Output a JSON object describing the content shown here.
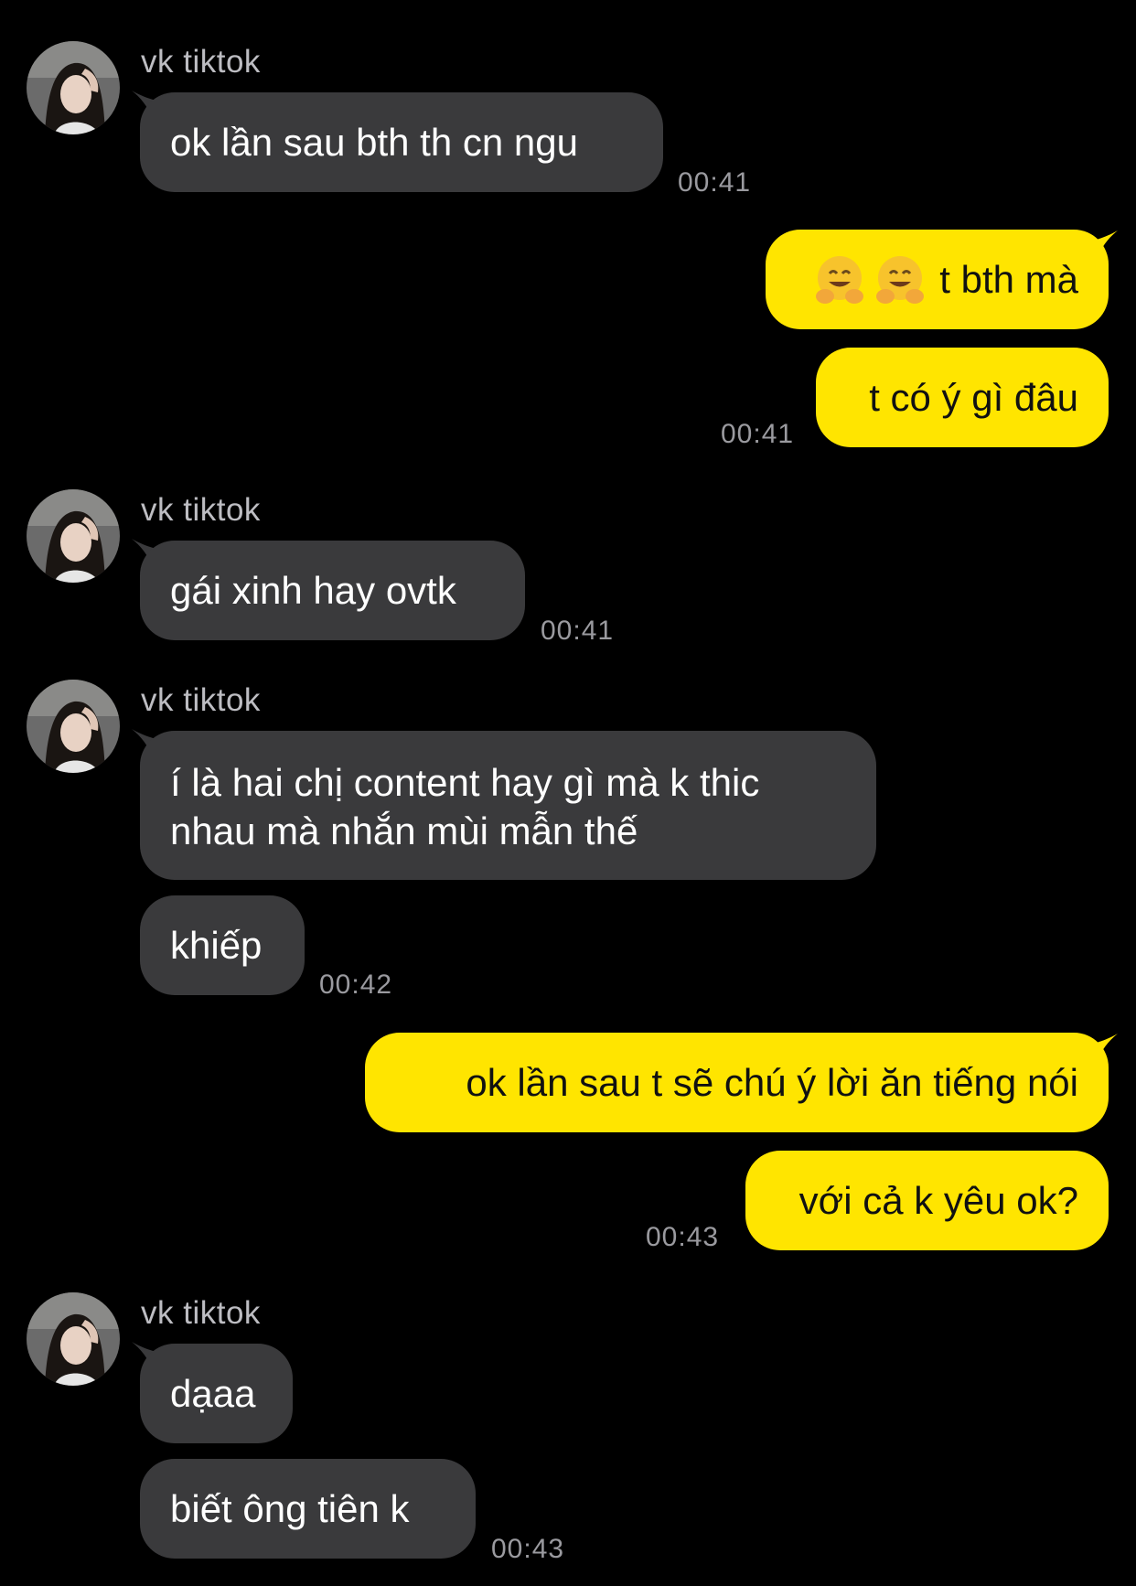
{
  "chat": {
    "sender_name": "vk tiktok",
    "messages": {
      "m1": {
        "text": "ok lần sau bth th cn ngu",
        "time": "00:41"
      },
      "m2": {
        "emojis": [
          "hugging-face",
          "hugging-face"
        ],
        "text": "t bth mà"
      },
      "m3": {
        "text": "t có ý gì đâu",
        "time": "00:41"
      },
      "m4": {
        "text": "gái xinh hay ovtk",
        "time": "00:41"
      },
      "m5": {
        "text": "í là hai chị content hay gì mà k thic nhau mà nhắn mùi mẫn thế"
      },
      "m6": {
        "text": "khiếp",
        "time": "00:42"
      },
      "m7": {
        "text": "ok lần sau t sẽ chú ý lời ăn tiếng nói"
      },
      "m8": {
        "text": "với cả k yêu ok?",
        "time": "00:43"
      },
      "m9": {
        "text": "dạaa"
      },
      "m10": {
        "text": "biết ông tiên k",
        "time": "00:43"
      }
    }
  },
  "colors": {
    "background": "#000000",
    "incoming_bubble": "#3a3a3c",
    "outgoing_bubble": "#ffe500",
    "timestamp": "#9a9a9f",
    "sender_name": "#bdbdc2"
  }
}
